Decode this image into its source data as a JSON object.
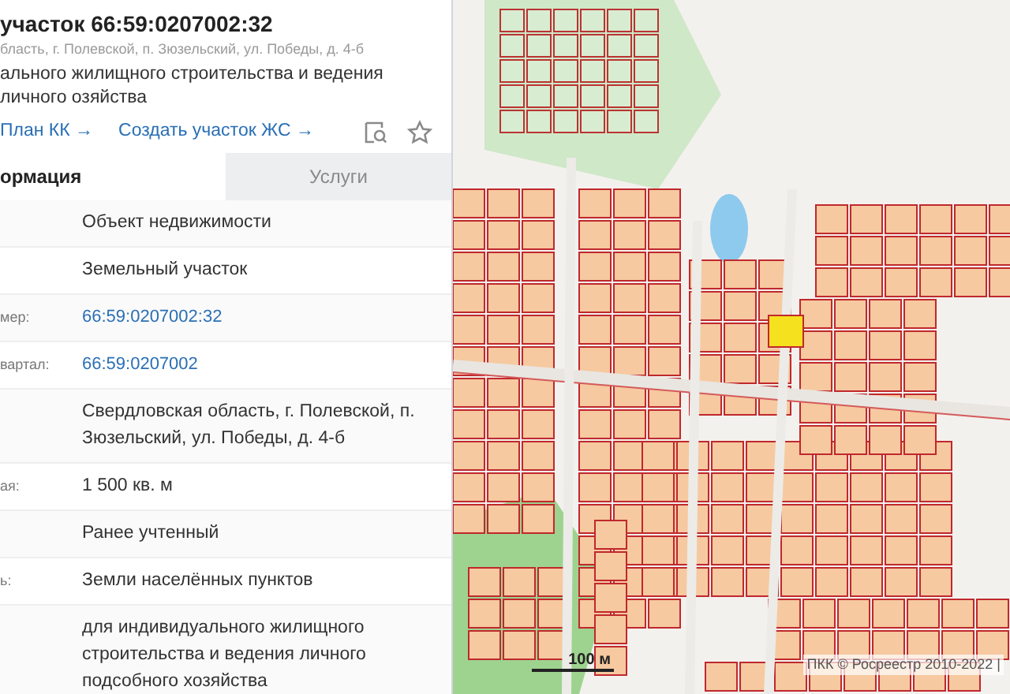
{
  "header": {
    "title": "участок 66:59:0207002:32",
    "address": "бласть, г. Полевской, п. Зюзельский, ул. Победы, д. 4-б",
    "description": "ального жилищного строительства и ведения личного озяйства"
  },
  "links": [
    "План КК →",
    "Создать участок ЖС →"
  ],
  "tabs": [
    {
      "label": "ормация",
      "selected": true
    },
    {
      "label": "Услуги",
      "selected": false
    }
  ],
  "rows": [
    {
      "label": "",
      "value": "Объект недвижимости",
      "kind": "text"
    },
    {
      "label": "",
      "value": "Земельный участок",
      "kind": "text"
    },
    {
      "label": "мер:",
      "value": "66:59:0207002:32",
      "kind": "link"
    },
    {
      "label": "вартал:",
      "value": "66:59:0207002",
      "kind": "link"
    },
    {
      "label": "",
      "value": "Свердловская область, г. Полевской, п. Зюзельский, ул. Победы, д. 4-б",
      "kind": "text"
    },
    {
      "label": "ая:",
      "value": "1 500 кв. м",
      "kind": "text"
    },
    {
      "label": "",
      "value": "Ранее учтенный",
      "kind": "text"
    },
    {
      "label": "ь:",
      "value": "Земли населённых пунктов",
      "kind": "text"
    },
    {
      "label": "",
      "value": "для индивидуального жилищного строительства и ведения личного подсобного хозяйства",
      "kind": "text"
    }
  ],
  "map": {
    "scale": "100 м",
    "attribution": "ПКК © Росреестр 2010-2022 |"
  }
}
